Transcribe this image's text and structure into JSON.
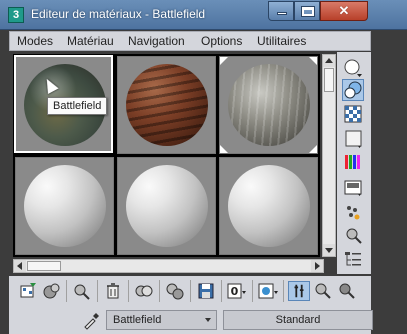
{
  "window": {
    "app_icon_label": "3",
    "title": "Editeur de matériaux - Battlefield",
    "close_glyph": "✕"
  },
  "menu": {
    "items": [
      "Modes",
      "Matériau",
      "Navigation",
      "Options",
      "Utilitaires"
    ]
  },
  "slots": [
    {
      "material": "earth",
      "active": true
    },
    {
      "material": "wood",
      "active": false
    },
    {
      "material": "stone",
      "active": false
    },
    {
      "material": "gray",
      "active": false
    },
    {
      "material": "gray",
      "active": false
    },
    {
      "material": "gray",
      "active": false
    }
  ],
  "tooltip": "Battlefield",
  "material_name": "Battlefield",
  "material_type": "Standard",
  "zero_label": "0",
  "colors": {
    "accent": "#4e73a0",
    "close": "#b8402a",
    "panel": "#d4d6dc",
    "active_tool": "#aac8e8"
  },
  "icons": {
    "right_toolbar": [
      "sample-type-sphere-icon",
      "backlight-icon",
      "background-checker-icon",
      "sample-uv-tiling-icon",
      "video-color-check-icon",
      "make-preview-icon",
      "options-icon",
      "select-by-material-icon",
      "material-map-navigator-icon"
    ],
    "bottom_toolbar": [
      "get-material-icon",
      "put-to-scene-icon",
      "assign-to-selection-icon",
      "reset-map-icon",
      "make-unique-icon",
      "put-to-library-icon",
      "material-id-channel-icon",
      "show-map-in-viewport-icon",
      "show-end-result-icon",
      "go-to-parent-icon",
      "go-forward-icon"
    ]
  }
}
